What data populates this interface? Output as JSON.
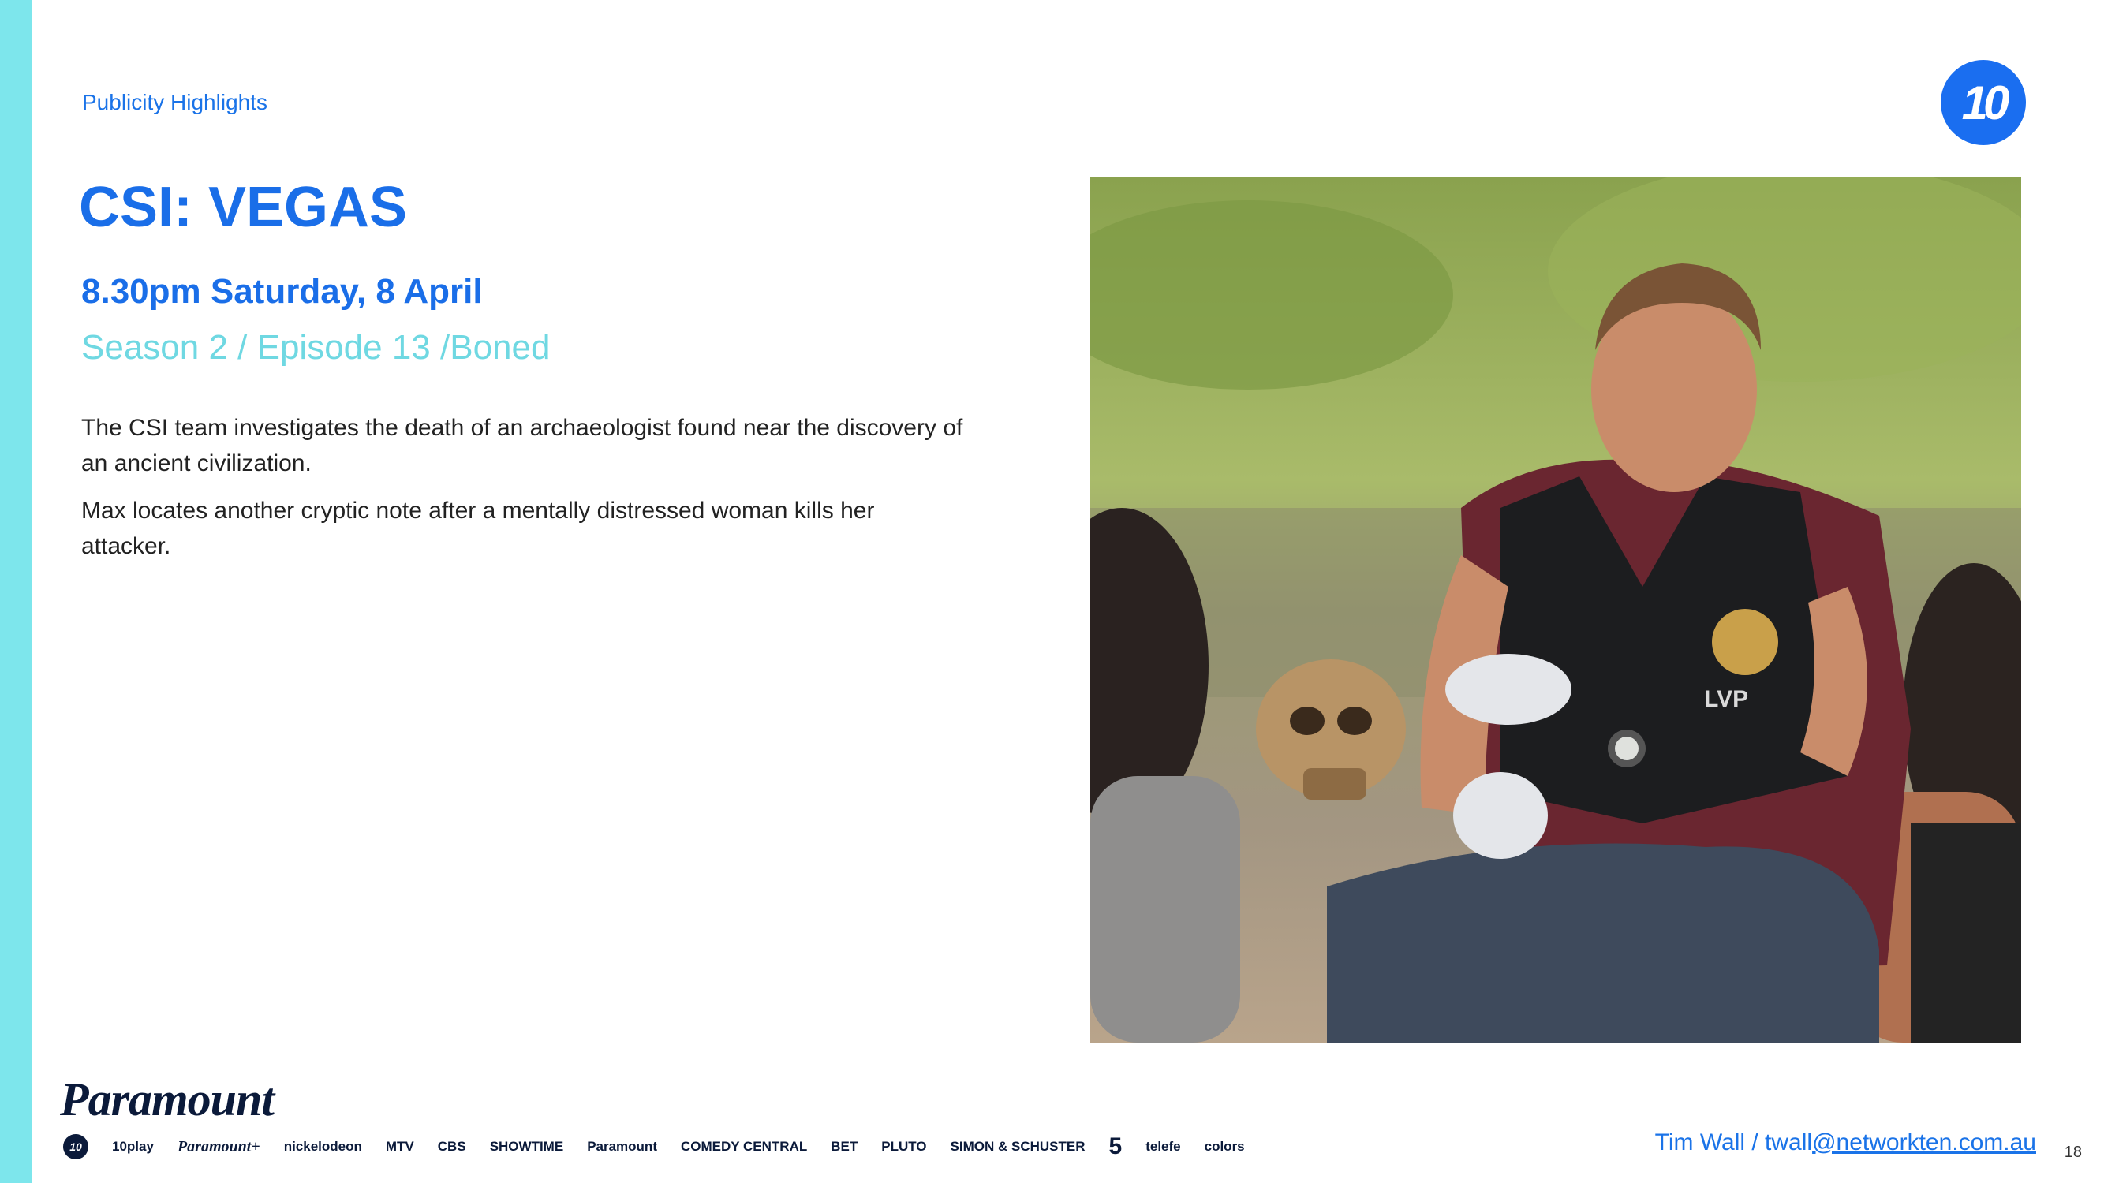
{
  "header": {
    "section_label": "Publicity Highlights",
    "logo_text": "10"
  },
  "show": {
    "title": "CSI: VEGAS",
    "airtime": "8.30pm Saturday, 8 April",
    "episode": "Season 2 / Episode 13 /Boned",
    "synopsis": [
      "The CSI team investigates the death of an archaeologist found near the discovery of an ancient civilization.",
      "Max locates another cryptic note after a mentally distressed woman kills her attacker."
    ]
  },
  "photo": {
    "badge_text": "LVP"
  },
  "footer": {
    "parent_brand": "Paramount",
    "brands": [
      "10",
      "10play",
      "Paramount+",
      "nickelodeon",
      "MTV",
      "CBS",
      "SHOWTIME",
      "Paramount",
      "COMEDY CENTRAL",
      "BET",
      "PLUTO",
      "SIMON & SCHUSTER",
      "5",
      "telefe",
      "colors"
    ],
    "contact_prefix": "Tim Wall / twall",
    "contact_link": "@networkten.com.au",
    "page_number": "18"
  },
  "colors": {
    "accent_blue": "#1a6ee8",
    "accent_teal": "#6fd8e2",
    "side_bar": "#7de6ec"
  }
}
